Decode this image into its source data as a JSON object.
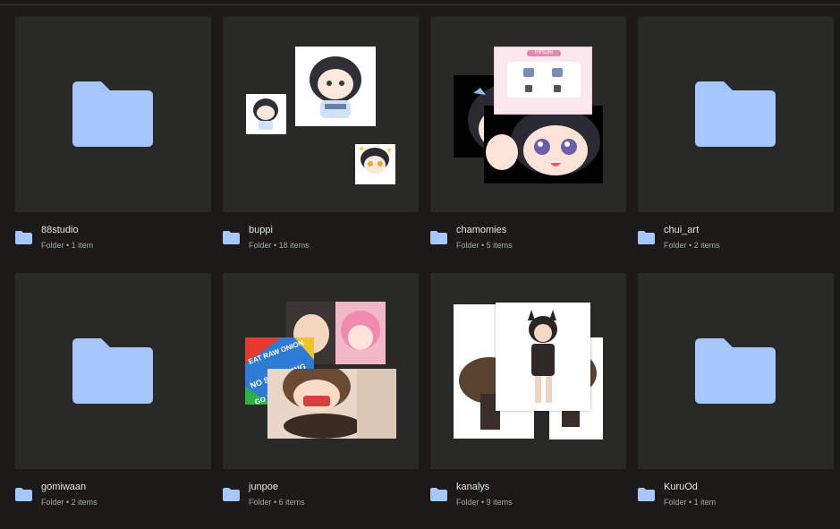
{
  "folders": [
    {
      "name": "88studio",
      "subtitle": "Folder • 1 item",
      "preview": "folder-icon"
    },
    {
      "name": "buppi",
      "subtitle": "Folder • 18 items",
      "preview": "image-stack"
    },
    {
      "name": "chamomies",
      "subtitle": "Folder • 5 items",
      "preview": "image-stack"
    },
    {
      "name": "chui_art",
      "subtitle": "Folder • 2 items",
      "preview": "folder-icon"
    },
    {
      "name": "gomiwaan",
      "subtitle": "Folder • 2 items",
      "preview": "folder-icon"
    },
    {
      "name": "junpoe",
      "subtitle": "Folder • 6 items",
      "preview": "image-stack"
    },
    {
      "name": "kanalys",
      "subtitle": "Folder • 9 items",
      "preview": "image-stack"
    },
    {
      "name": "KuruOd",
      "subtitle": "Folder • 1 item",
      "preview": "folder-icon"
    }
  ],
  "previews": {
    "chamomies_card": {
      "title": "PIPSUNI"
    },
    "junpoe_sign": [
      "EAT RAW ONION",
      "NO SWEARING",
      "GO BALD"
    ]
  },
  "colors": {
    "background": "#1b1a19",
    "tile": "#292928",
    "folder_blue": "#a5c6ff",
    "name_text": "#e6e6e6",
    "sub_text": "#a8a8a8"
  }
}
